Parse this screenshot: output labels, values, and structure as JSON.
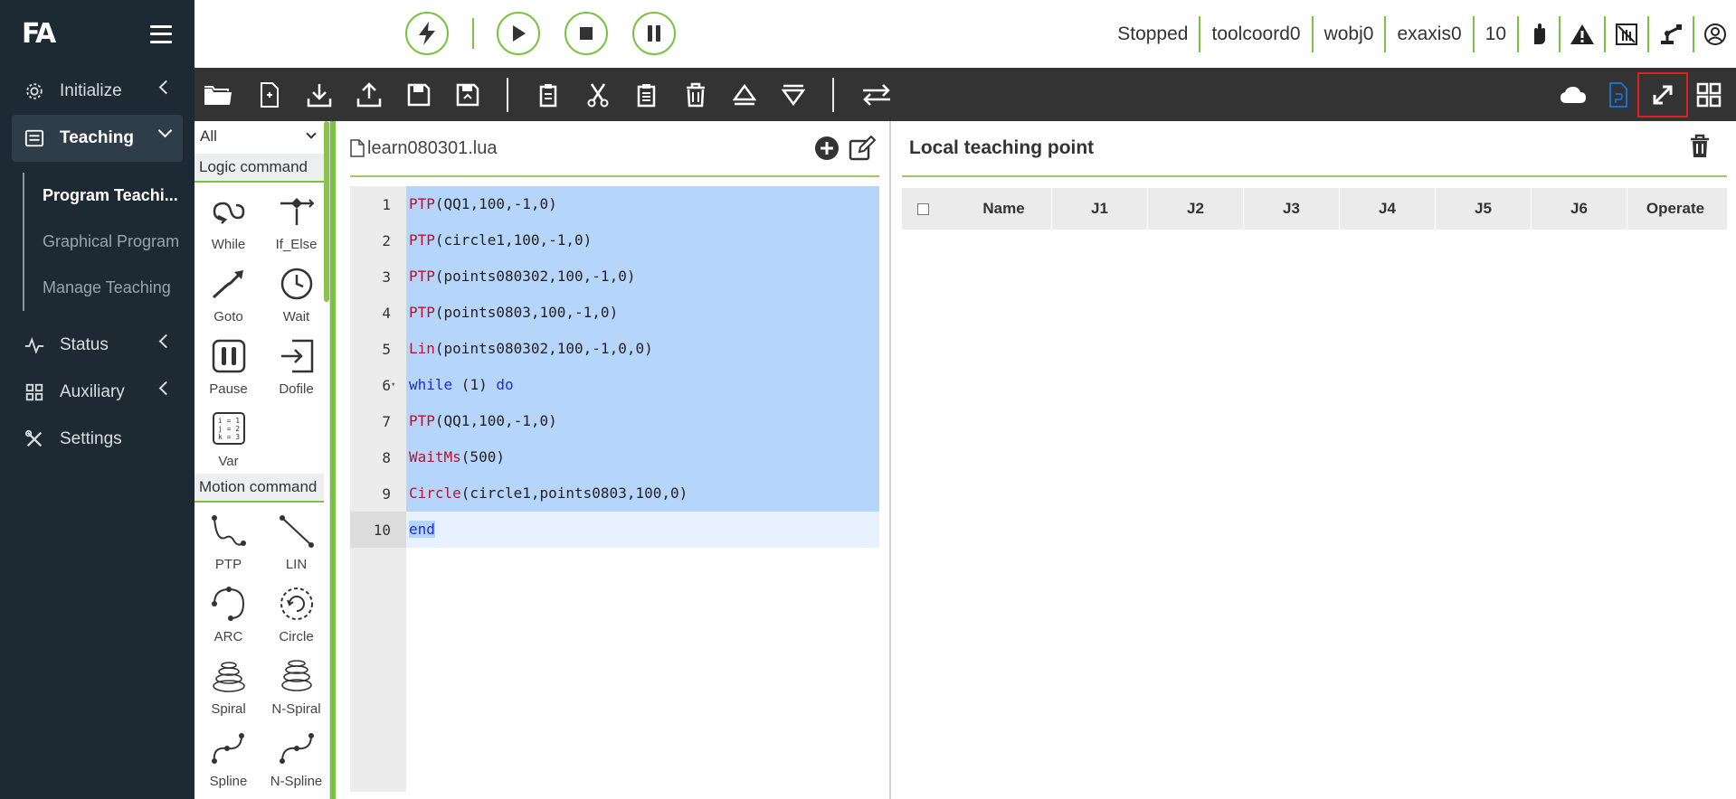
{
  "sidebar": {
    "logo": "FA",
    "items": [
      {
        "label": "Initialize"
      },
      {
        "label": "Teaching"
      },
      {
        "label": "Status"
      },
      {
        "label": "Auxiliary"
      },
      {
        "label": "Settings"
      }
    ],
    "teaching_sub": [
      {
        "label": "Program Teachi..."
      },
      {
        "label": "Graphical Program"
      },
      {
        "label": "Manage Teaching"
      }
    ]
  },
  "status": {
    "state": "Stopped",
    "tool": "toolcoord0",
    "wobj": "wobj0",
    "exaxis": "exaxis0",
    "speed": "10"
  },
  "palette": {
    "filter": "All",
    "logic_title": "Logic command",
    "logic": [
      "While",
      "If_Else",
      "Goto",
      "Wait",
      "Pause",
      "Dofile",
      "Var"
    ],
    "motion_title": "Motion command",
    "motion": [
      "PTP",
      "LIN",
      "ARC",
      "Circle",
      "Spiral",
      "N-Spiral",
      "Spline",
      "N-Spline"
    ]
  },
  "editor": {
    "file_name": "learn080301.lua",
    "lines": [
      {
        "n": "1",
        "kw": "PTP",
        "rest": "(QQ1,100,-1,0)"
      },
      {
        "n": "2",
        "kw": "PTP",
        "rest": "(circle1,100,-1,0)"
      },
      {
        "n": "3",
        "kw": "PTP",
        "rest": "(points080302,100,-1,0)"
      },
      {
        "n": "4",
        "kw": "PTP",
        "rest": "(points0803,100,-1,0)"
      },
      {
        "n": "5",
        "kw": "Lin",
        "rest": "(points080302,100,-1,0,0)"
      },
      {
        "n": "6",
        "kw": "while",
        "rest": " (1) ",
        "kw2": "do"
      },
      {
        "n": "7",
        "kw": "PTP",
        "rest": "(QQ1,100,-1,0)"
      },
      {
        "n": "8",
        "kw": "WaitMs",
        "rest": "(500)"
      },
      {
        "n": "9",
        "kw": "Circle",
        "rest": "(circle1,points0803,100,0)"
      },
      {
        "n": "10",
        "kw": "end",
        "rest": ""
      }
    ]
  },
  "points_panel": {
    "title": "Local teaching point",
    "columns": [
      "Name",
      "J1",
      "J2",
      "J3",
      "J4",
      "J5",
      "J6",
      "Operate"
    ]
  }
}
